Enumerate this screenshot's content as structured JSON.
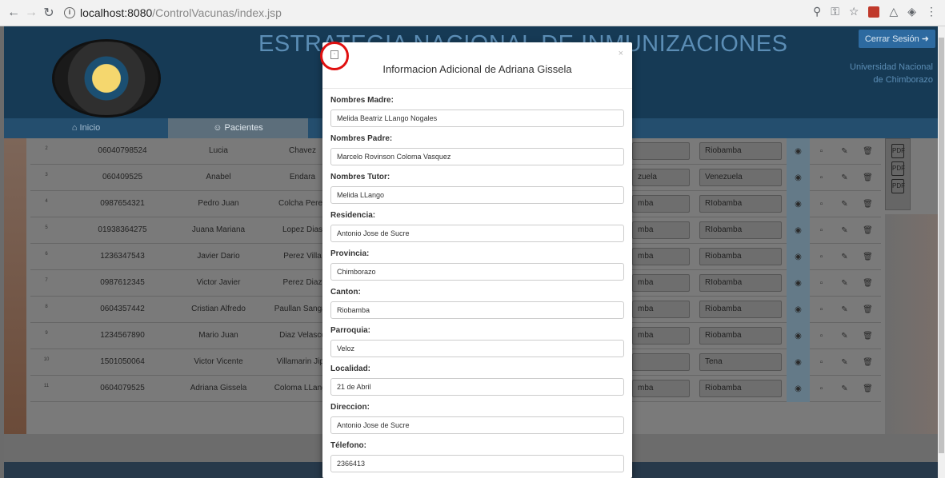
{
  "browser": {
    "url_host": "localhost:8080",
    "url_path": "/ControlVacunas/index.jsp",
    "back_icon": "arrow-left-icon",
    "forward_icon": "arrow-right-icon",
    "reload_icon": "reload-icon"
  },
  "header": {
    "title": "ESTRATEGIA NACIONAL DE INMUNIZACIONES",
    "logout_label": "Cerrar Sesión",
    "university_line1": "Universidad Nacional",
    "university_line2": "de Chimborazo"
  },
  "tabs": [
    {
      "label": "Inicio",
      "icon": "home-icon"
    },
    {
      "label": "Pacientes",
      "icon": "users-icon"
    }
  ],
  "table": {
    "rows": [
      {
        "num": "2",
        "ci": "06040798524",
        "first": "Lucia",
        "last": "Chavez",
        "a": "",
        "b": "Riobamba"
      },
      {
        "num": "3",
        "ci": "060409525",
        "first": "Anabel",
        "last": "Endara",
        "a": "zuela",
        "b": "Venezuela"
      },
      {
        "num": "4",
        "ci": "0987654321",
        "first": "Pedro Juan",
        "last": "Colcha Perez",
        "a": "mba",
        "b": "RIobamba"
      },
      {
        "num": "5",
        "ci": "01938364275",
        "first": "Juana Mariana",
        "last": "Lopez Dias",
        "a": "mba",
        "b": "RIobamba"
      },
      {
        "num": "6",
        "ci": "1236347543",
        "first": "Javier Dario",
        "last": "Perez Villa",
        "a": "mba",
        "b": "Riobamba"
      },
      {
        "num": "7",
        "ci": "0987612345",
        "first": "Victor Javier",
        "last": "Perez Diaz",
        "a": "mba",
        "b": "RIobamba"
      },
      {
        "num": "8",
        "ci": "0604357442",
        "first": "Cristian Alfredo",
        "last": "Paullan Sangan",
        "a": "mba",
        "b": "Riobamba"
      },
      {
        "num": "9",
        "ci": "1234567890",
        "first": "Mario Juan",
        "last": "Diaz Velasco",
        "a": "mba",
        "b": "Riobamba"
      },
      {
        "num": "10",
        "ci": "1501050064",
        "first": "Victor Vicente",
        "last": "Villamarin Jipa",
        "a": "",
        "b": "Tena"
      },
      {
        "num": "11",
        "ci": "0604079525",
        "first": "Adriana Gissela",
        "last": "Coloma LLango",
        "a": "mba",
        "b": "Riobamba"
      }
    ]
  },
  "modal": {
    "title": "Informacion Adicional de Adriana Gissela",
    "close": "×",
    "fields": [
      {
        "label": "Nombres Madre:",
        "value": "Melida Beatriz LLango Nogales"
      },
      {
        "label": "Nombres Padre:",
        "value": "Marcelo Rovinson Coloma Vasquez"
      },
      {
        "label": "Nombres Tutor:",
        "value": "Melida LLango"
      },
      {
        "label": "Residencia:",
        "value": "Antonio Jose de Sucre"
      },
      {
        "label": "Provincia:",
        "value": "Chimborazo"
      },
      {
        "label": "Canton:",
        "value": "Riobamba"
      },
      {
        "label": "Parroquia:",
        "value": "Veloz"
      },
      {
        "label": "Localidad:",
        "value": "21 de Abril"
      },
      {
        "label": "Direccion:",
        "value": "Antonio Jose de Sucre"
      },
      {
        "label": "Télefono:",
        "value": "2366413"
      }
    ]
  }
}
